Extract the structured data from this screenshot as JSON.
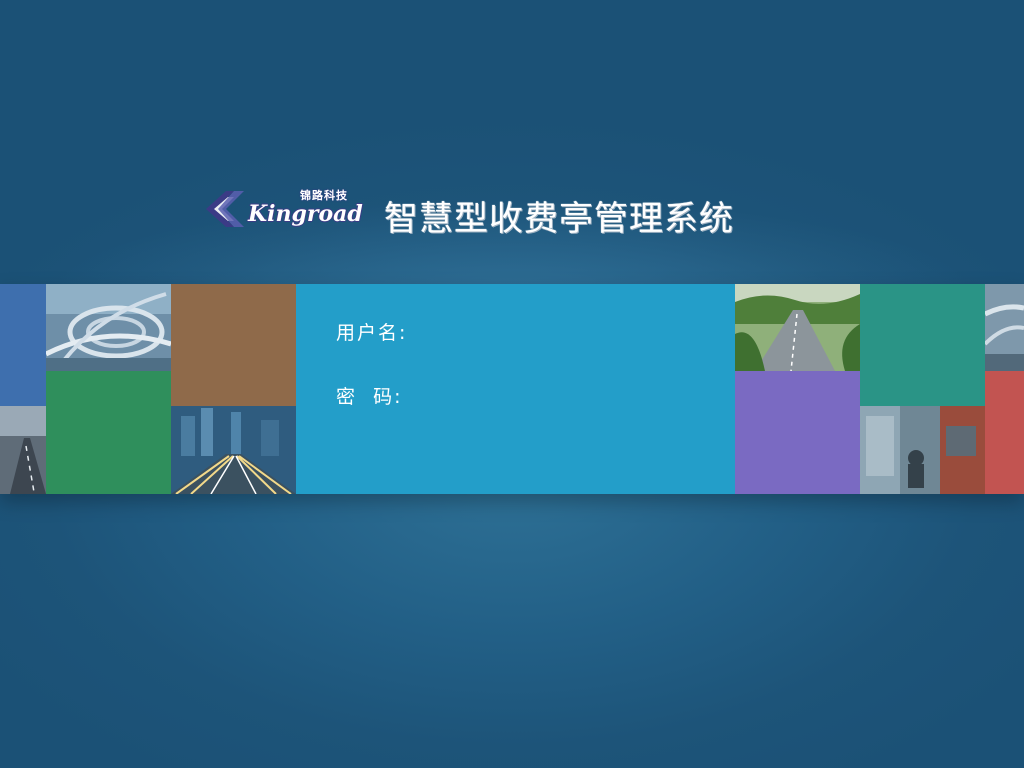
{
  "header": {
    "logo": {
      "cn": "锦路科技",
      "en": "Kingroad"
    },
    "system_title": "智慧型收费亭管理系统"
  },
  "login": {
    "username_label": "用户名:",
    "username_value": "",
    "password_label": "密  码:",
    "password_value": ""
  },
  "tiles": [
    {
      "name": "tile-blue",
      "color": "#3e6fae",
      "kind": "solid"
    },
    {
      "name": "tile-highway-interchange-photo",
      "kind": "photo"
    },
    {
      "name": "tile-brown",
      "color": "#8f6a4a",
      "kind": "solid"
    },
    {
      "name": "tile-road-fog-photo",
      "kind": "photo"
    },
    {
      "name": "tile-green",
      "color": "#2f8f5c",
      "kind": "solid"
    },
    {
      "name": "tile-city-traffic-night-photo",
      "kind": "photo"
    },
    {
      "name": "tile-mountain-expressway-photo",
      "kind": "photo"
    },
    {
      "name": "tile-purple",
      "color": "#7a6ac2",
      "kind": "solid"
    },
    {
      "name": "tile-teal",
      "color": "#2a9486",
      "kind": "solid"
    },
    {
      "name": "tile-toll-booth-photo",
      "kind": "photo"
    },
    {
      "name": "tile-overpass-photo",
      "kind": "photo"
    },
    {
      "name": "tile-red",
      "color": "#c25451",
      "kind": "solid"
    }
  ],
  "colors": {
    "background": "#225f86",
    "login_panel": "#239ec9",
    "text": "#ffffff"
  }
}
